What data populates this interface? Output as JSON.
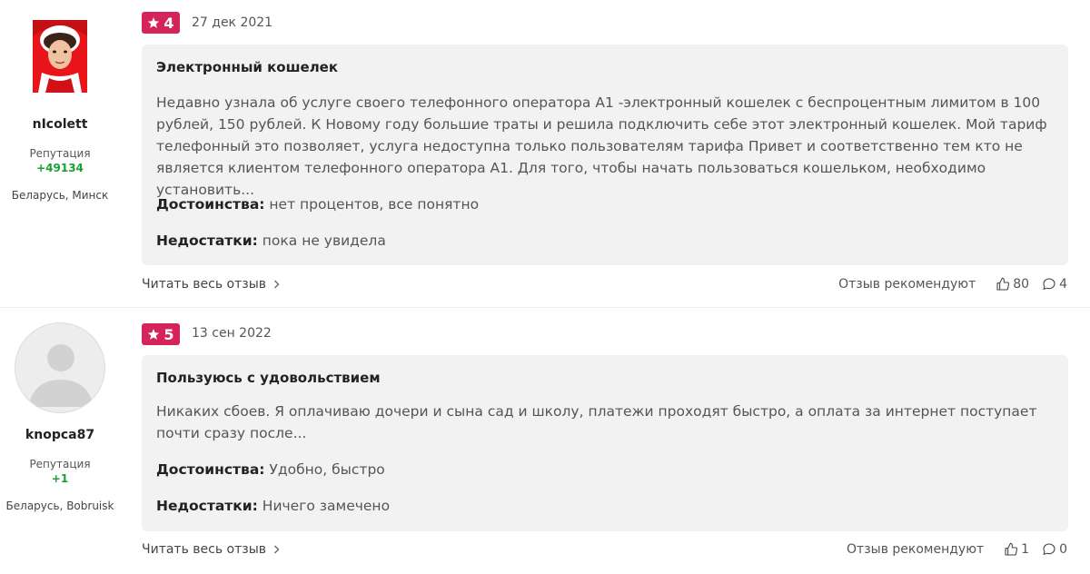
{
  "reviews": [
    {
      "author": {
        "username": "nIcolett",
        "reputation_label": "Репутация",
        "reputation_value": "+49134",
        "location": "Беларусь, Минск"
      },
      "rating": "4",
      "date": "27 дек 2021",
      "title": "Электронный кошелек",
      "text": "Недавно узнала об услуге своего телефонного оператора А1 -электронный кошелек с беспроцентным лимитом в 100 рублей, 150 рублей. К Новому году большие траты и решила подключить себе этот электронный кошелек. Мой тариф телефонный это позволяет, услуга недоступна только пользователям тарифа Привет и соответственно тем кто не является клиентом телефонного оператора А1. Для того, чтобы начать пользоваться кошельком, необходимо установить...",
      "pros_label": "Достоинства:",
      "pros": "нет процентов, все понятно",
      "cons_label": "Недостатки:",
      "cons": "пока не увидела",
      "read_more": "Читать весь отзыв",
      "recommend_label": "Отзыв рекомендуют",
      "likes": "80",
      "comments": "4"
    },
    {
      "author": {
        "username": "knopca87",
        "reputation_label": "Репутация",
        "reputation_value": "+1",
        "location": "Беларусь, Bobruisk"
      },
      "rating": "5",
      "date": "13 сен 2022",
      "title": "Пользуюсь с удовольствием",
      "text": "Никаких сбоев. Я оплачиваю дочери и сына сад и школу, платежи проходят быстро, а оплата за интернет поступает почти сразу после...",
      "pros_label": "Достоинства:",
      "pros": "Удобно, быстро",
      "cons_label": "Недостатки:",
      "cons": "Ничего замечено",
      "read_more": "Читать весь отзыв",
      "recommend_label": "Отзыв рекомендуют",
      "likes": "1",
      "comments": "0"
    }
  ],
  "colors": {
    "rating_badge": "#d4245a",
    "reputation": "#1aa033",
    "card_background": "#f2f2f2"
  }
}
